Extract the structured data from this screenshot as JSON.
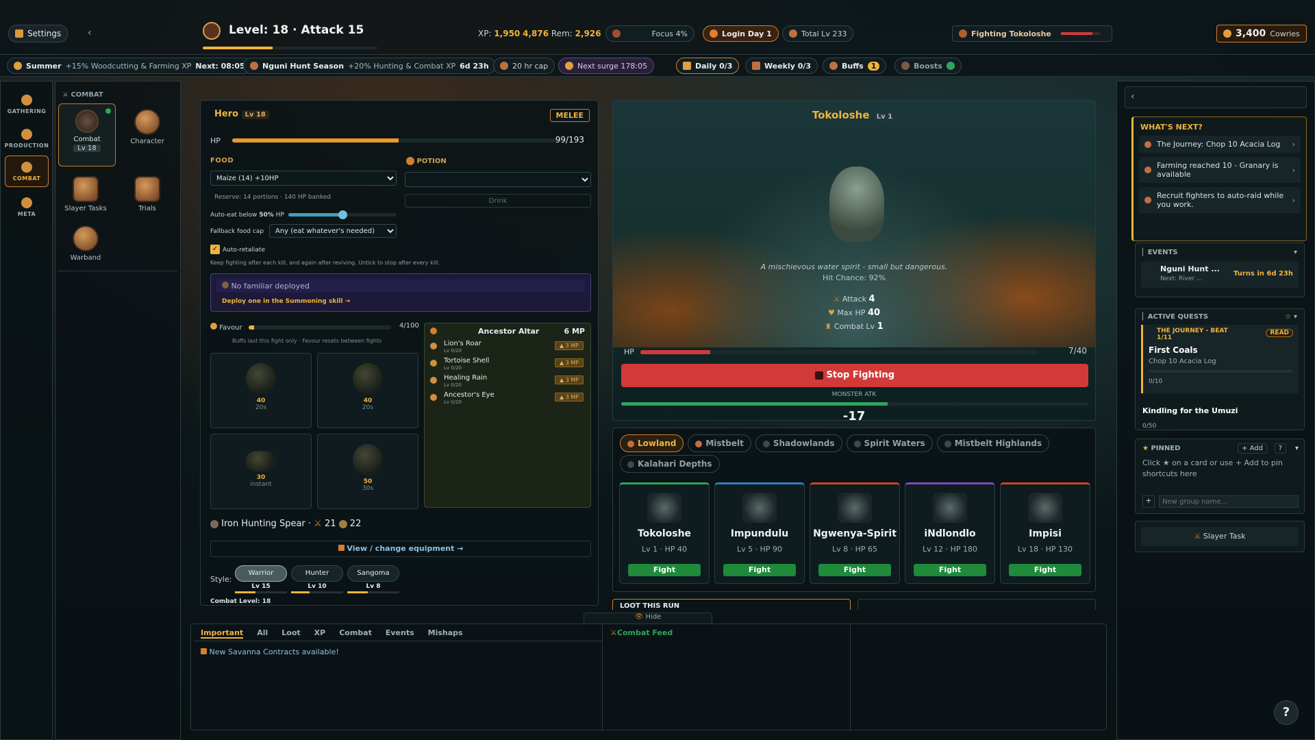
{
  "topbar": {
    "settings": "Settings",
    "level_title": "Level: 18 · Attack 15",
    "xp_label": "XP:",
    "xp_value": "1,950",
    "xp_total": "4,876",
    "rem_label": "Rem:",
    "rem_value": "2,926",
    "focus": "Focus 4%",
    "login": "Login Day 1",
    "total_lv": "Total Lv 233",
    "fighting": "Fighting Tokoloshe",
    "cowries_value": "3,400",
    "cowries_label": "Cowries"
  },
  "subbar": {
    "season": "Summer",
    "season_bonus": "+15% Woodcutting & Farming XP",
    "season_next": "Next: 08:05",
    "hunt": "Nguni Hunt Season",
    "hunt_bonus": "+20% Hunting & Combat XP",
    "hunt_time": "6d 23h",
    "cap": "20 hr cap",
    "surge": "Next surge 178:05",
    "daily": "Daily 0/3",
    "weekly": "Weekly 0/3",
    "buffs": "Buffs",
    "buffs_count": "1",
    "boosts": "Boosts"
  },
  "sidebar": {
    "gathering": "GATHERING",
    "production": "PRODUCTION",
    "combat": "COMBAT",
    "meta": "META"
  },
  "combat_nav": {
    "header": "COMBAT",
    "combat": "Combat",
    "combat_lv": "Lv 18",
    "character": "Character",
    "slayer": "Slayer Tasks",
    "trials": "Trials",
    "warband": "Warband"
  },
  "hero": {
    "name": "Hero",
    "lv": "Lv 18",
    "style": "MELEE",
    "hp_label": "HP",
    "hp_text": "99/193",
    "hp_frac": 0.513,
    "food_label": "FOOD",
    "food_value": "Maize (14) +10HP",
    "potion_label": "POTION",
    "drink": "Drink",
    "reserve": "Reserve: 14 portions · 140 HP banked",
    "autoeat_label": "Auto-eat below",
    "autoeat_value": "50%",
    "autoeat_suffix": "HP",
    "autoeat_frac": 0.5,
    "fallback_label": "Fallback food cap",
    "fallback_value": "Any (eat whatever's needed)",
    "retaliate": "Auto-retaliate",
    "retaliate_hint": "Keep fighting after each kill, and again after reviving. Untick to stop after every kill.",
    "familiar": "No familiar deployed",
    "familiar_link": "Deploy one in the Summoning skill →",
    "favour_label": "Favour",
    "favour_text": "4/100",
    "favour_frac": 0.04,
    "favour_hint": "Buffs last this fight only · Favour resets between fights",
    "slots": [
      {
        "cost": "40",
        "time": "20s"
      },
      {
        "cost": "40",
        "time": "20s"
      },
      {
        "cost": "30",
        "time": "instant"
      },
      {
        "cost": "50",
        "time": "30s"
      }
    ],
    "altar": {
      "title": "Ancestor Altar",
      "mp": "6 MP",
      "items": [
        {
          "name": "Lion's Roar",
          "lv": "Lv 0/20",
          "cost": "▲ 3 MP"
        },
        {
          "name": "Tortoise Shell",
          "lv": "Lv 0/20",
          "cost": "▲ 3 MP"
        },
        {
          "name": "Healing Rain",
          "lv": "Lv 0/20",
          "cost": "▲ 3 MP"
        },
        {
          "name": "Ancestor's Eye",
          "lv": "Lv 0/20",
          "cost": "▲ 3 MP"
        }
      ]
    },
    "weapon": "Iron Hunting Spear ·",
    "weapon_atk": "21",
    "weapon_def": "22",
    "equip_link": "View / change equipment →",
    "style_label": "Style:",
    "styles": [
      {
        "name": "Warrior",
        "lv": "Lv 15",
        "frac": 0.4
      },
      {
        "name": "Hunter",
        "lv": "Lv 10",
        "frac": 0.35
      },
      {
        "name": "Sangoma",
        "lv": "Lv 8",
        "frac": 0.4
      }
    ],
    "combat_level": "Combat Level: 18"
  },
  "monster": {
    "name": "Tokoloshe",
    "lv": "Lv 1",
    "desc": "A mischievous water spirit - small but dangerous.",
    "hit": "Hit Chance: 92%",
    "attack_label": "Attack",
    "attack": "4",
    "maxhp_label": "Max HP",
    "maxhp": "40",
    "clv_label": "Combat Lv",
    "clv": "1",
    "hp_label": "HP",
    "hp_text": "7/40",
    "hp_frac": 0.175,
    "stop": "Stop Fighting",
    "atk_label": "MONSTER ATK",
    "atk_frac": 0.57,
    "dmg": "-17"
  },
  "zones": [
    "Lowland",
    "Mistbelt",
    "Shadowlands",
    "Spirit Waters",
    "Mistbelt Highlands",
    "Kalahari Depths"
  ],
  "monsters": [
    {
      "name": "Tokoloshe",
      "stats": "Lv 1 · HP 40",
      "color": "#2fa55a"
    },
    {
      "name": "Impundulu",
      "stats": "Lv 5 · HP 90",
      "color": "#2f7fbf"
    },
    {
      "name": "Ngwenya-Spirit",
      "stats": "Lv 8 · HP 65",
      "color": "#c8452f"
    },
    {
      "name": "iNdlondlo",
      "stats": "Lv 12 · HP 180",
      "color": "#7b4bc2"
    },
    {
      "name": "Impisi",
      "stats": "Lv 18 · HP 130",
      "color": "#c8452f"
    }
  ],
  "fight": "Fight",
  "loot": "LOOT THIS RUN",
  "bottom": {
    "hide": "Hide",
    "tabs": [
      "Important",
      "All",
      "Loot",
      "XP",
      "Combat",
      "Events",
      "Mishaps"
    ],
    "notice": "New Savanna Contracts available!",
    "feed": "Combat Feed"
  },
  "right": {
    "whats_next": "WHAT'S NEXT?",
    "next_items": [
      "The Journey: Chop 10 Acacia Log",
      "Farming reached 10 - Granary is available",
      "Recruit fighters to auto-raid while you work."
    ],
    "events": "EVENTS",
    "event_name": "Nguni Hunt ...",
    "event_sub": "Next:",
    "event_sub2": "River ...",
    "event_turn": "Turns in 6d 23h",
    "quests": "ACTIVE QUESTS",
    "quest_beat": "THE JOURNEY - BEAT 1/11",
    "quest_read": "READ",
    "quest_title": "First Coals",
    "quest_task": "Chop 10 Acacia Log",
    "quest_prog": "0/10",
    "quest2": "Kindling for the Umuzi",
    "quest2_prog": "0/50",
    "pinned": "PINNED",
    "add": "+ Add",
    "help": "?",
    "pinned_hint": "Click ★ on a card or use + Add to pin shortcuts here",
    "group_ph": "New group name...",
    "slayer": "Slayer Task"
  },
  "colors": {
    "accent": "#f0b43c",
    "hp": "#e89a2a",
    "red": "#d23a3a",
    "green": "#1e8a3a"
  }
}
